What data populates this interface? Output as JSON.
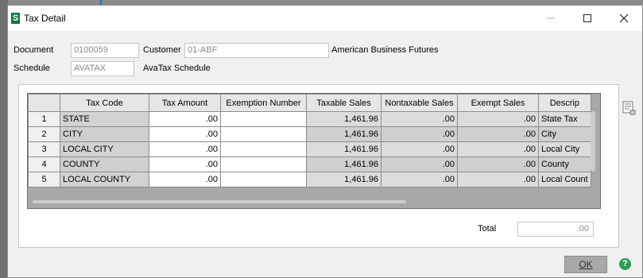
{
  "window": {
    "title": "Tax Detail",
    "app_icon_glyph": "S"
  },
  "header": {
    "document_label": "Document",
    "document_value": "0100059",
    "customer_label": "Customer",
    "customer_value": "01-ABF",
    "customer_name": "American Business Futures",
    "schedule_label": "Schedule",
    "schedule_value": "AVATAX",
    "schedule_desc": "AvaTax Schedule"
  },
  "grid": {
    "columns": [
      "Tax Code",
      "Tax Amount",
      "Exemption Number",
      "Taxable Sales",
      "Nontaxable Sales",
      "Exempt Sales",
      "Descrip"
    ],
    "rows": [
      {
        "num": "1",
        "code": "STATE",
        "amount": ".00",
        "exemption": "",
        "taxable": "1,461.96",
        "nontaxable": ".00",
        "exempt": ".00",
        "desc": "State Tax"
      },
      {
        "num": "2",
        "code": "CITY",
        "amount": ".00",
        "exemption": "",
        "taxable": "1,461.96",
        "nontaxable": ".00",
        "exempt": ".00",
        "desc": "City"
      },
      {
        "num": "3",
        "code": "LOCAL CITY",
        "amount": ".00",
        "exemption": "",
        "taxable": "1,461.96",
        "nontaxable": ".00",
        "exempt": ".00",
        "desc": "Local City"
      },
      {
        "num": "4",
        "code": "COUNTY",
        "amount": ".00",
        "exemption": "",
        "taxable": "1,461.96",
        "nontaxable": ".00",
        "exempt": ".00",
        "desc": "County"
      },
      {
        "num": "5",
        "code": "LOCAL COUNTY",
        "amount": ".00",
        "exemption": "",
        "taxable": "1,461.96",
        "nontaxable": ".00",
        "exempt": ".00",
        "desc": "Local Count"
      }
    ]
  },
  "footer": {
    "total_label": "Total",
    "total_value": ".00",
    "ok_label": "OK",
    "help_glyph": "?"
  },
  "icons": {
    "app": "sage-app-icon",
    "minimize": "minimize-icon",
    "maximize": "maximize-icon",
    "close": "close-icon",
    "grid_options": "grid-options-icon",
    "help": "help-icon"
  },
  "colors": {
    "app_icon": "#0c7a3e",
    "help": "#2e9c57",
    "accent": "#1f6fc8"
  }
}
